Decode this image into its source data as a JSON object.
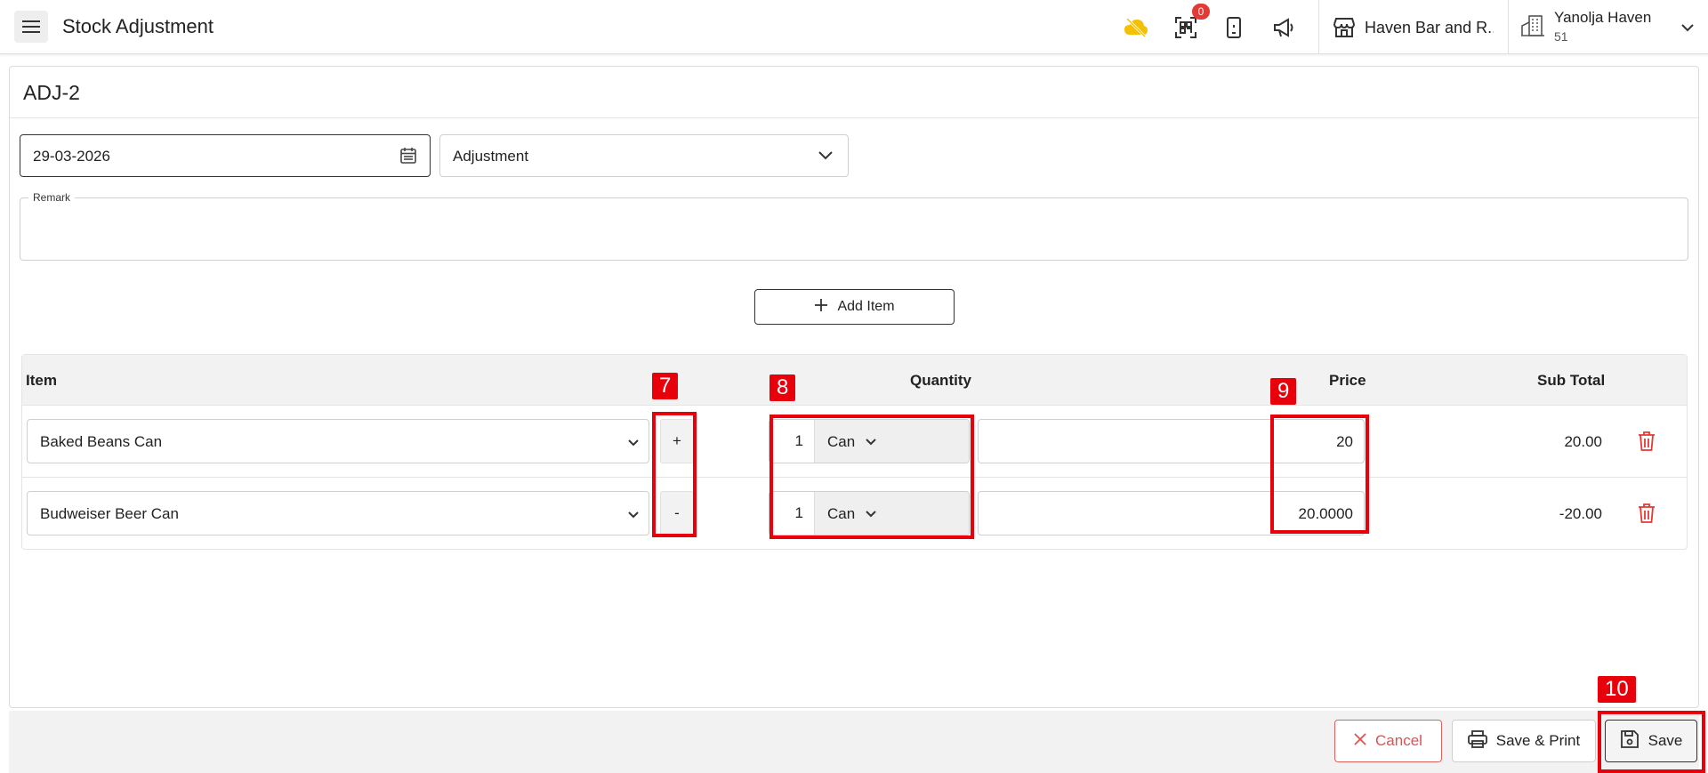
{
  "header": {
    "title": "Stock Adjustment",
    "notification_count": "0",
    "store_name": "Haven Bar and R...",
    "user_name": "Yanolja Haven",
    "user_sub": "51"
  },
  "form": {
    "doc_id": "ADJ-2",
    "date": "29-03-2026",
    "type": "Adjustment",
    "remark_label": "Remark",
    "remark_value": "",
    "add_item_label": "Add Item"
  },
  "table": {
    "headers": {
      "item": "Item",
      "quantity": "Quantity",
      "price": "Price",
      "subtotal": "Sub Total"
    },
    "rows": [
      {
        "item": "Baked Beans Can",
        "sign": "+",
        "qty": "1",
        "unit": "Can",
        "price": "20",
        "subtotal": "20.00"
      },
      {
        "item": "Budweiser Beer Can",
        "sign": "-",
        "qty": "1",
        "unit": "Can",
        "price": "20.0000",
        "subtotal": "-20.00"
      }
    ]
  },
  "footer": {
    "cancel_label": "Cancel",
    "print_label": "Save & Print",
    "save_label": "Save"
  },
  "annotations": [
    "7",
    "8",
    "9",
    "10"
  ],
  "colors": {
    "accent_red": "#e8000b",
    "delete_red": "#e53935",
    "cloud_yellow": "#f5c000"
  }
}
